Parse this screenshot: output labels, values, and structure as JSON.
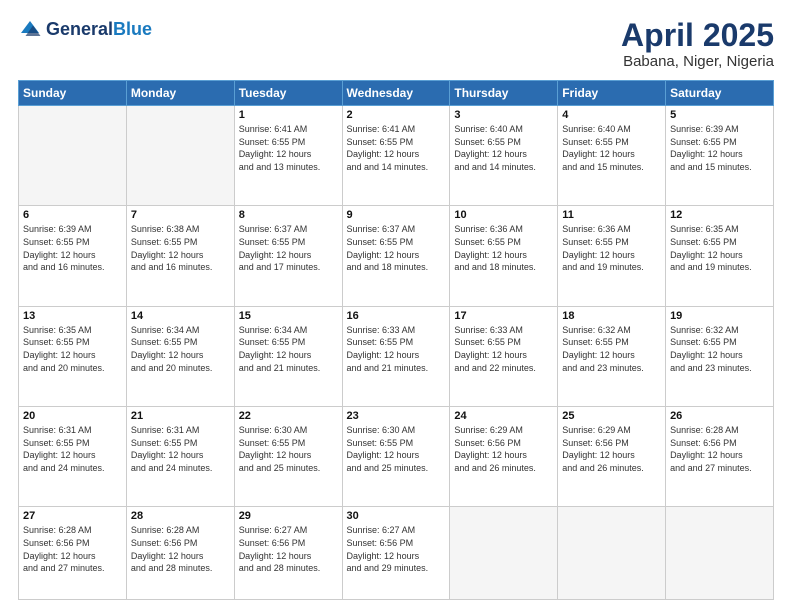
{
  "header": {
    "logo_line1": "General",
    "logo_line2": "Blue",
    "month_title": "April 2025",
    "location": "Babana, Niger, Nigeria"
  },
  "days_of_week": [
    "Sunday",
    "Monday",
    "Tuesday",
    "Wednesday",
    "Thursday",
    "Friday",
    "Saturday"
  ],
  "weeks": [
    [
      {
        "num": "",
        "info": ""
      },
      {
        "num": "",
        "info": ""
      },
      {
        "num": "1",
        "info": "Sunrise: 6:41 AM\nSunset: 6:55 PM\nDaylight: 12 hours and 13 minutes."
      },
      {
        "num": "2",
        "info": "Sunrise: 6:41 AM\nSunset: 6:55 PM\nDaylight: 12 hours and 14 minutes."
      },
      {
        "num": "3",
        "info": "Sunrise: 6:40 AM\nSunset: 6:55 PM\nDaylight: 12 hours and 14 minutes."
      },
      {
        "num": "4",
        "info": "Sunrise: 6:40 AM\nSunset: 6:55 PM\nDaylight: 12 hours and 15 minutes."
      },
      {
        "num": "5",
        "info": "Sunrise: 6:39 AM\nSunset: 6:55 PM\nDaylight: 12 hours and 15 minutes."
      }
    ],
    [
      {
        "num": "6",
        "info": "Sunrise: 6:39 AM\nSunset: 6:55 PM\nDaylight: 12 hours and 16 minutes."
      },
      {
        "num": "7",
        "info": "Sunrise: 6:38 AM\nSunset: 6:55 PM\nDaylight: 12 hours and 16 minutes."
      },
      {
        "num": "8",
        "info": "Sunrise: 6:37 AM\nSunset: 6:55 PM\nDaylight: 12 hours and 17 minutes."
      },
      {
        "num": "9",
        "info": "Sunrise: 6:37 AM\nSunset: 6:55 PM\nDaylight: 12 hours and 18 minutes."
      },
      {
        "num": "10",
        "info": "Sunrise: 6:36 AM\nSunset: 6:55 PM\nDaylight: 12 hours and 18 minutes."
      },
      {
        "num": "11",
        "info": "Sunrise: 6:36 AM\nSunset: 6:55 PM\nDaylight: 12 hours and 19 minutes."
      },
      {
        "num": "12",
        "info": "Sunrise: 6:35 AM\nSunset: 6:55 PM\nDaylight: 12 hours and 19 minutes."
      }
    ],
    [
      {
        "num": "13",
        "info": "Sunrise: 6:35 AM\nSunset: 6:55 PM\nDaylight: 12 hours and 20 minutes."
      },
      {
        "num": "14",
        "info": "Sunrise: 6:34 AM\nSunset: 6:55 PM\nDaylight: 12 hours and 20 minutes."
      },
      {
        "num": "15",
        "info": "Sunrise: 6:34 AM\nSunset: 6:55 PM\nDaylight: 12 hours and 21 minutes."
      },
      {
        "num": "16",
        "info": "Sunrise: 6:33 AM\nSunset: 6:55 PM\nDaylight: 12 hours and 21 minutes."
      },
      {
        "num": "17",
        "info": "Sunrise: 6:33 AM\nSunset: 6:55 PM\nDaylight: 12 hours and 22 minutes."
      },
      {
        "num": "18",
        "info": "Sunrise: 6:32 AM\nSunset: 6:55 PM\nDaylight: 12 hours and 23 minutes."
      },
      {
        "num": "19",
        "info": "Sunrise: 6:32 AM\nSunset: 6:55 PM\nDaylight: 12 hours and 23 minutes."
      }
    ],
    [
      {
        "num": "20",
        "info": "Sunrise: 6:31 AM\nSunset: 6:55 PM\nDaylight: 12 hours and 24 minutes."
      },
      {
        "num": "21",
        "info": "Sunrise: 6:31 AM\nSunset: 6:55 PM\nDaylight: 12 hours and 24 minutes."
      },
      {
        "num": "22",
        "info": "Sunrise: 6:30 AM\nSunset: 6:55 PM\nDaylight: 12 hours and 25 minutes."
      },
      {
        "num": "23",
        "info": "Sunrise: 6:30 AM\nSunset: 6:55 PM\nDaylight: 12 hours and 25 minutes."
      },
      {
        "num": "24",
        "info": "Sunrise: 6:29 AM\nSunset: 6:56 PM\nDaylight: 12 hours and 26 minutes."
      },
      {
        "num": "25",
        "info": "Sunrise: 6:29 AM\nSunset: 6:56 PM\nDaylight: 12 hours and 26 minutes."
      },
      {
        "num": "26",
        "info": "Sunrise: 6:28 AM\nSunset: 6:56 PM\nDaylight: 12 hours and 27 minutes."
      }
    ],
    [
      {
        "num": "27",
        "info": "Sunrise: 6:28 AM\nSunset: 6:56 PM\nDaylight: 12 hours and 27 minutes."
      },
      {
        "num": "28",
        "info": "Sunrise: 6:28 AM\nSunset: 6:56 PM\nDaylight: 12 hours and 28 minutes."
      },
      {
        "num": "29",
        "info": "Sunrise: 6:27 AM\nSunset: 6:56 PM\nDaylight: 12 hours and 28 minutes."
      },
      {
        "num": "30",
        "info": "Sunrise: 6:27 AM\nSunset: 6:56 PM\nDaylight: 12 hours and 29 minutes."
      },
      {
        "num": "",
        "info": ""
      },
      {
        "num": "",
        "info": ""
      },
      {
        "num": "",
        "info": ""
      }
    ]
  ]
}
